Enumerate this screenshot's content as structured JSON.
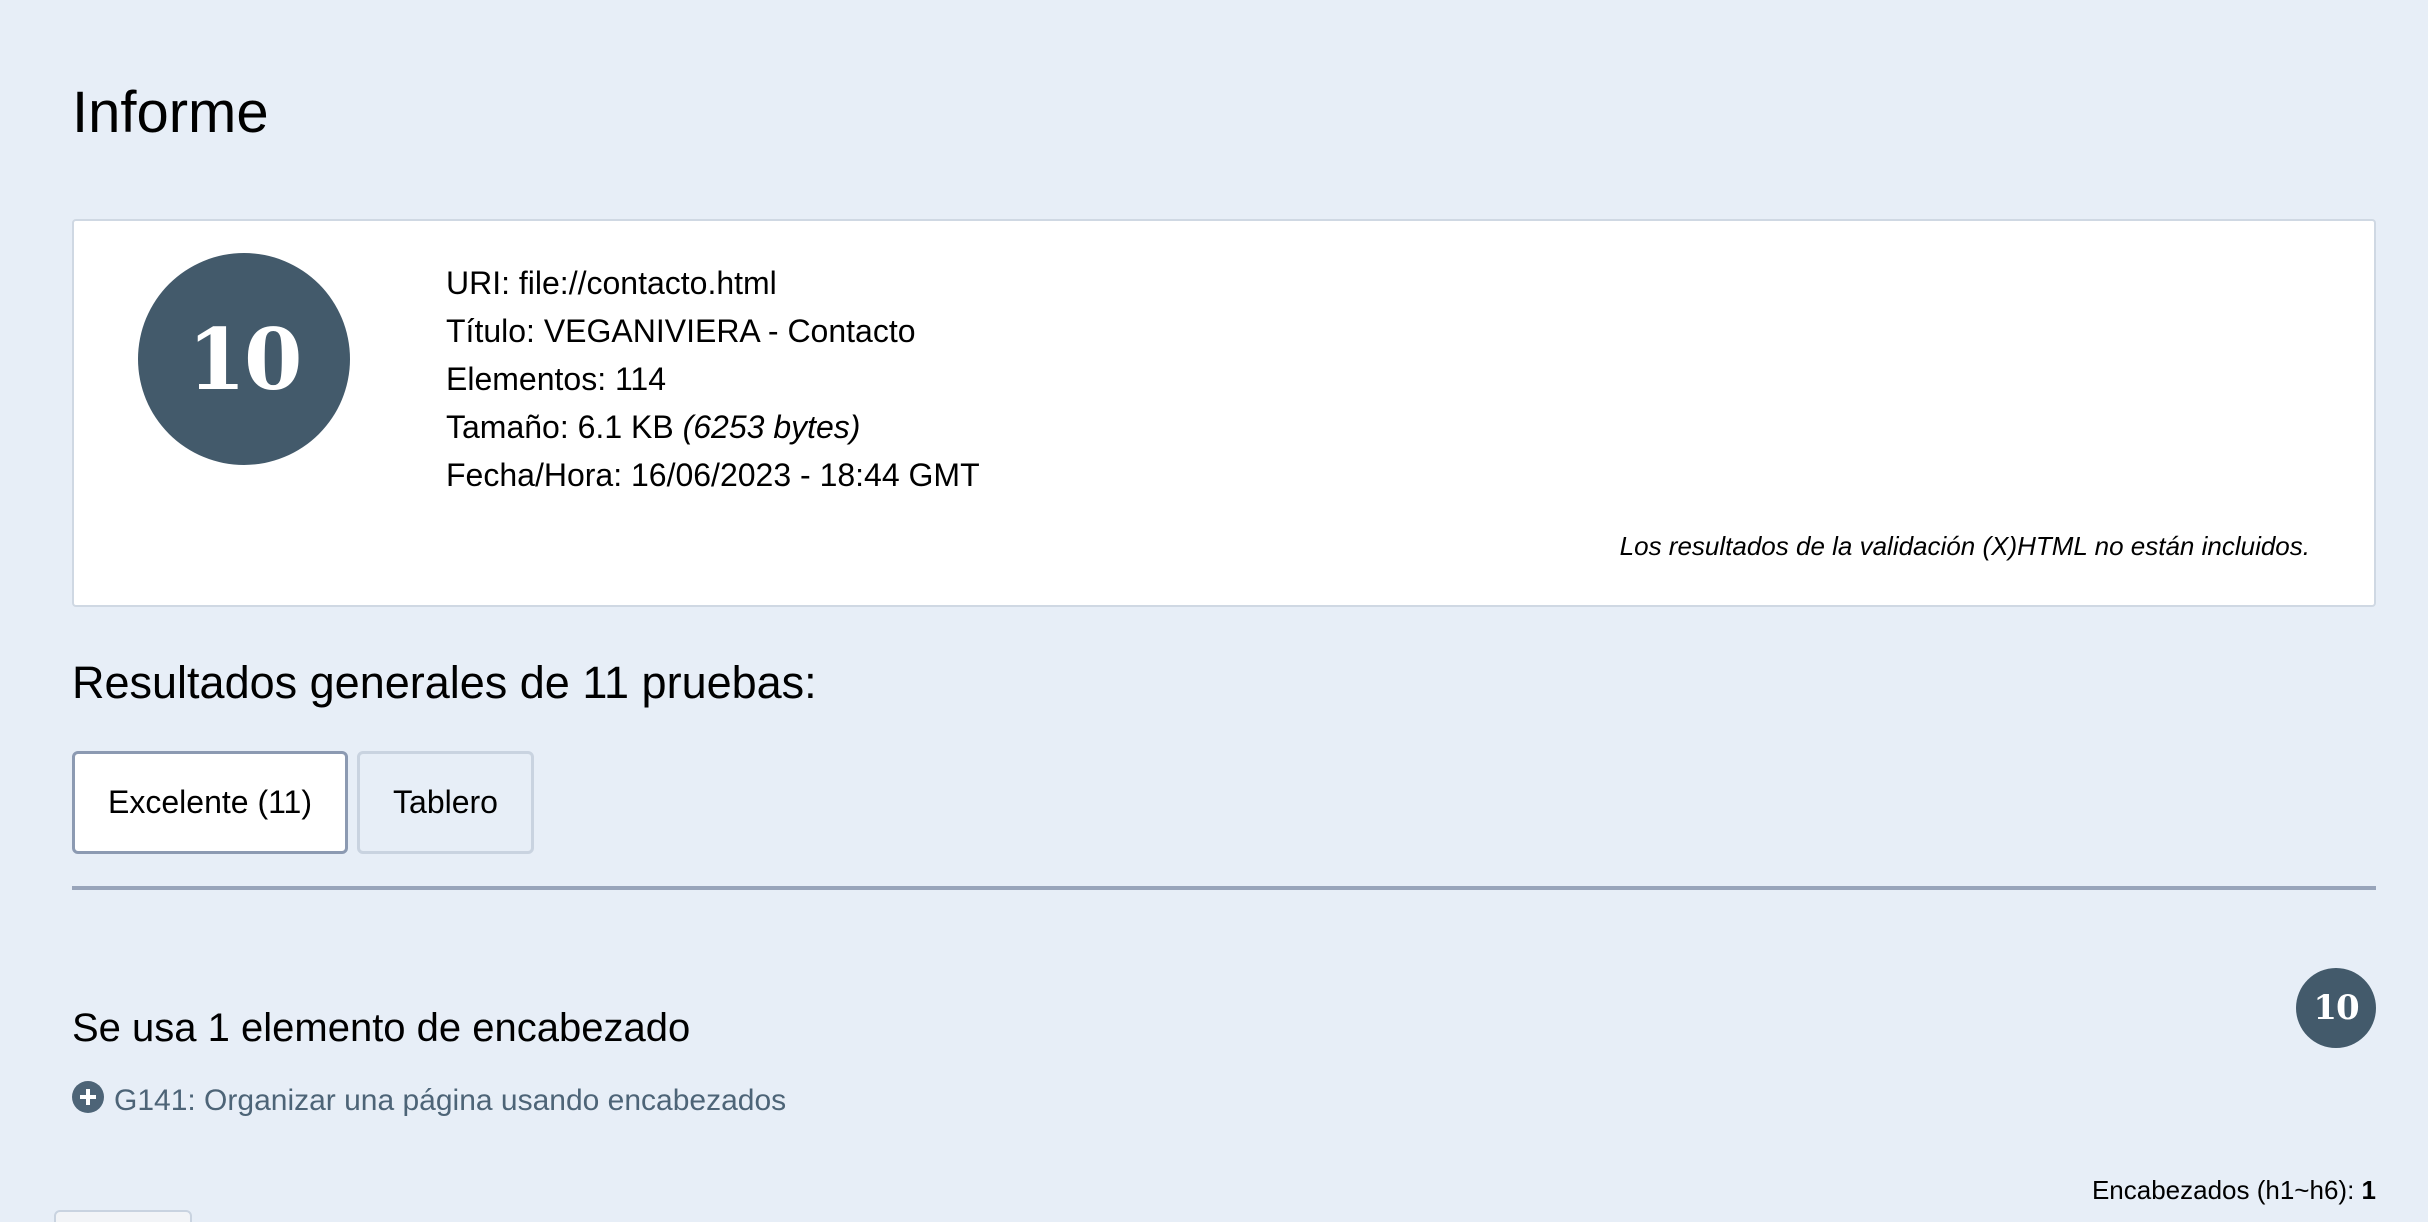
{
  "page": {
    "title": "Informe"
  },
  "summary": {
    "score": "10",
    "uri_label": "URI:",
    "uri_value": "file://contacto.html",
    "title_label": "Título:",
    "title_value": "VEGANIVIERA - Contacto",
    "elements_label": "Elementos:",
    "elements_value": "114",
    "size_label": "Tamaño:",
    "size_value": "6.1 KB",
    "size_bytes": "(6253 bytes)",
    "datetime_label": "Fecha/Hora:",
    "datetime_value": "16/06/2023 - 18:44 GMT",
    "validation_note": "Los resultados de la validación (X)HTML no están incluidos."
  },
  "results": {
    "heading": "Resultados generales de 11 pruebas:",
    "tabs": [
      {
        "label": "Excelente (11)",
        "selected": true
      },
      {
        "label": "Tablero",
        "selected": false
      }
    ]
  },
  "check": {
    "score": "10",
    "title": "Se usa 1 elemento de encabezado",
    "technique": "G141: Organizar una página usando encabezados",
    "technique_icon": "plus-circle-icon",
    "count_label": "Encabezados (h1~h6):",
    "count_value": "1"
  },
  "colors": {
    "background": "#e7eef7",
    "score_badge": "#435a6b",
    "link": "#4d6477",
    "divider": "#98a4ba"
  }
}
